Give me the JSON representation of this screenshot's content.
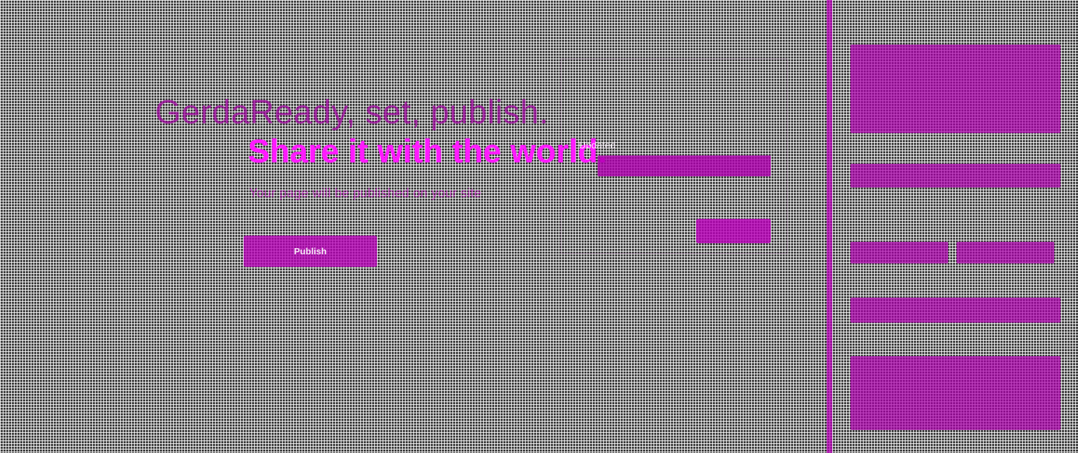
{
  "editor": {
    "background_title": "GerdaReady, set, publish."
  },
  "dialog": {
    "headline": "Share it with the world.",
    "subheadline": "Your page will be published on your site",
    "primary_button_label": "Publish"
  },
  "background_panel": {
    "visible_label": "Updated"
  },
  "colors": {
    "accent": "#ff1aff",
    "overlay": "#b400b4",
    "background": "#3f3f3f"
  }
}
